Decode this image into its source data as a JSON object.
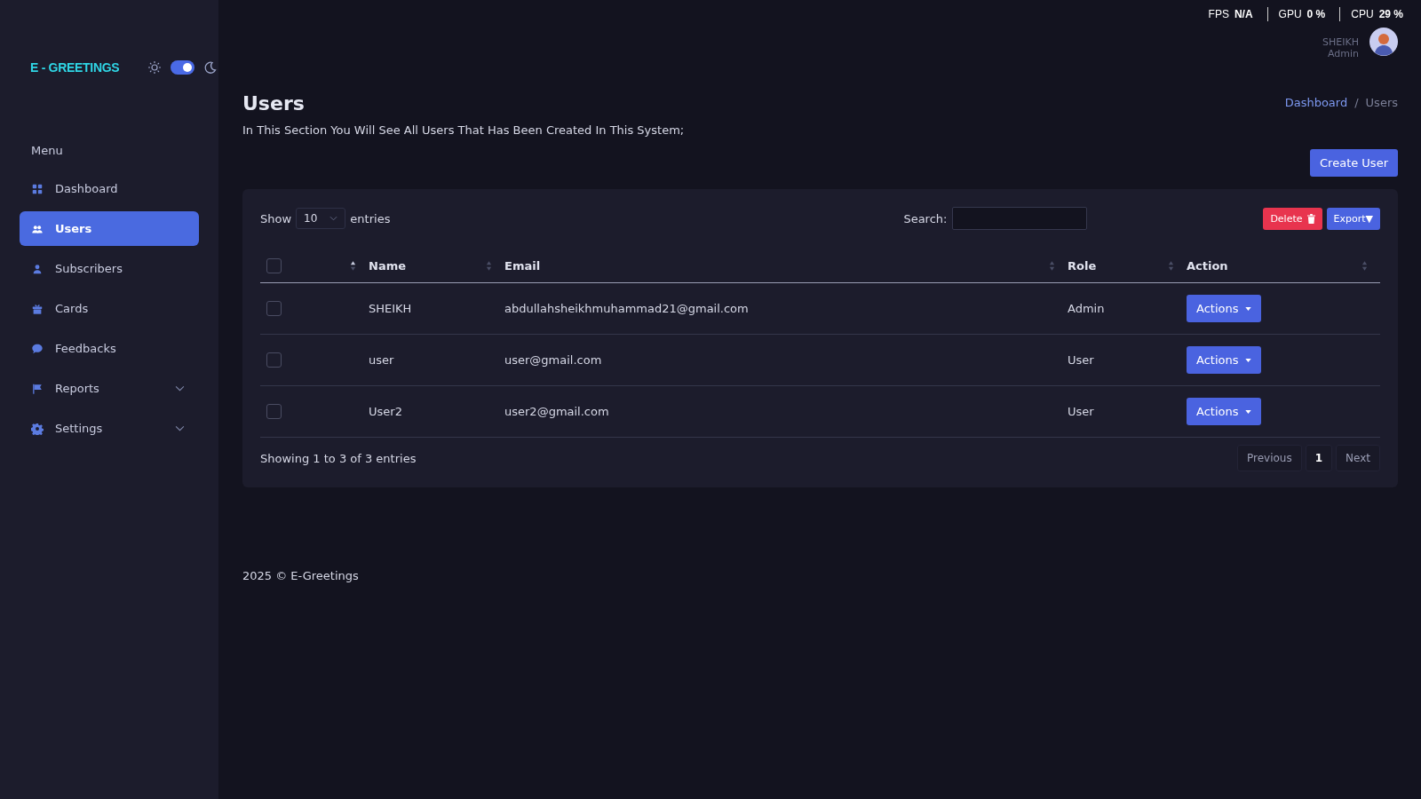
{
  "perf_overlay": [
    {
      "label": "FPS",
      "value": "N/A"
    },
    {
      "label": "GPU",
      "value": "0 %"
    },
    {
      "label": "CPU",
      "value": "29 %"
    }
  ],
  "brand": {
    "logo": "E - GREETINGS",
    "dark_mode": {
      "on": true
    }
  },
  "user": {
    "name": "SHEIKH",
    "role": "Admin"
  },
  "sidebar": {
    "heading": "Menu",
    "items": [
      {
        "label": "Dashboard",
        "selected": false,
        "has_submenu": false
      },
      {
        "label": "Users",
        "selected": true,
        "has_submenu": false
      },
      {
        "label": "Subscribers",
        "selected": false,
        "has_submenu": false
      },
      {
        "label": "Cards",
        "selected": false,
        "has_submenu": false
      },
      {
        "label": "Feedbacks",
        "selected": false,
        "has_submenu": false
      },
      {
        "label": "Reports",
        "selected": false,
        "has_submenu": true
      },
      {
        "label": "Settings",
        "selected": false,
        "has_submenu": true
      }
    ]
  },
  "page": {
    "title": "Users",
    "subtitle": "In This Section You Will See All Users That Has Been Created In This System;",
    "breadcrumb": [
      {
        "label": "Dashboard",
        "link": true
      },
      {
        "label": "Users",
        "link": false
      }
    ],
    "breadcrumb_separator": "/",
    "create_button": "Create User"
  },
  "table": {
    "show_label": "Show",
    "page_size": "10",
    "entries_label": "entries",
    "search_label": "Search:",
    "delete_button": "Delete",
    "export_button": "Export▼",
    "select_all": {
      "checked": false,
      "sorted": true
    },
    "columns": [
      {
        "label": "Name",
        "sorted": false
      },
      {
        "label": "Email",
        "sorted": false
      },
      {
        "label": "Role",
        "sorted": false
      },
      {
        "label": "Action",
        "sorted": false
      }
    ],
    "rows": [
      {
        "checked": false,
        "name": "SHEIKH",
        "email": "abdullahsheikhmuhammad21@gmail.com",
        "role": "Admin",
        "action": "Actions"
      },
      {
        "checked": false,
        "name": "user",
        "email": "user@gmail.com",
        "role": "User",
        "action": "Actions"
      },
      {
        "checked": false,
        "name": "User2",
        "email": "user2@gmail.com",
        "role": "User",
        "action": "Actions"
      }
    ],
    "info": "Showing 1 to 3 of 3 entries",
    "pagination": [
      {
        "label": "Previous",
        "selected": false
      },
      {
        "label": "1",
        "selected": true
      },
      {
        "label": "Next",
        "selected": false
      }
    ]
  },
  "footer": "2025 © E-Greetings"
}
